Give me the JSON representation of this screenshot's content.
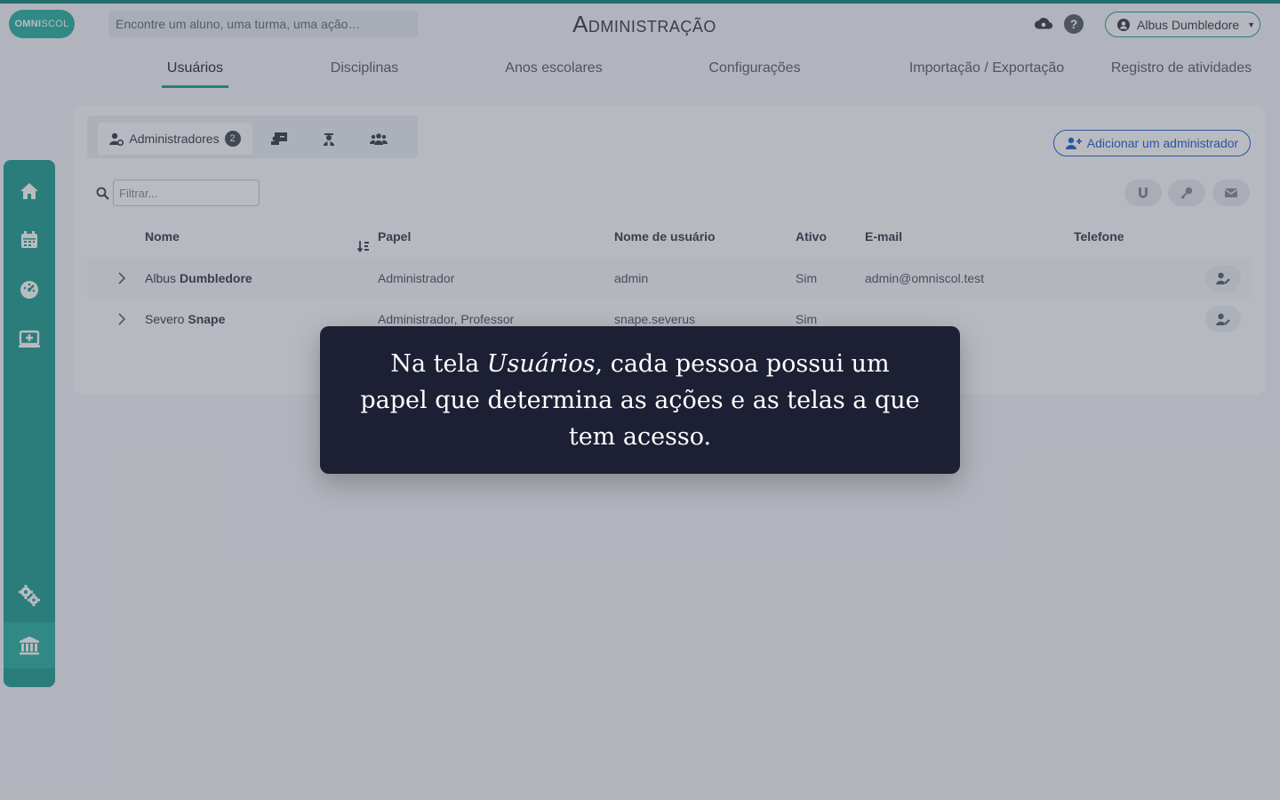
{
  "header": {
    "logo_bold": "OMNI",
    "logo_light": "SCOL",
    "search_placeholder": "Encontre um aluno, uma turma, uma ação…",
    "title": "Administração",
    "user_name": "Albus Dumbledore",
    "help_icon_text": "?"
  },
  "tabs": [
    {
      "label": "Usuários",
      "active": true
    },
    {
      "label": "Disciplinas"
    },
    {
      "label": "Anos escolares"
    },
    {
      "label": "Configurações"
    },
    {
      "label": "Importação / Exportação"
    },
    {
      "label": "Registro de atividades"
    }
  ],
  "sidebar": {
    "items": [
      "home-icon",
      "calendar-icon",
      "dashboard-icon",
      "screen-add-icon",
      "cogs-icon",
      "institution-icon"
    ]
  },
  "subtabs": {
    "active_label": "Administradores",
    "active_count": "2",
    "others": [
      "teacher-board-icon",
      "student-icon",
      "group-icon"
    ]
  },
  "add_button_label": "Adicionar um administrador",
  "filter_placeholder": "Filtrar...",
  "table": {
    "headers": {
      "name": "Nome",
      "role": "Papel",
      "username": "Nome de usuário",
      "active": "Ativo",
      "email": "E-mail",
      "phone": "Telefone"
    },
    "rows": [
      {
        "first": "Albus",
        "last": "Dumbledore",
        "role": "Administrador",
        "username": "admin",
        "active": "Sim",
        "email": "admin@omniscol.test",
        "phone": ""
      },
      {
        "first": "Severo",
        "last": "Snape",
        "role": "Administrador, Professor",
        "username": "snape.severus",
        "active": "Sim",
        "email": "",
        "phone": ""
      }
    ]
  },
  "tooltip": {
    "before": "Na tela ",
    "emphasis": "Usuários",
    "after": ", cada pessoa possui um papel que determina as ações e as telas a que tem acesso."
  },
  "colors": {
    "accent": "#26a194",
    "link_blue": "#2666c9",
    "tooltip_bg": "#1d2034"
  }
}
